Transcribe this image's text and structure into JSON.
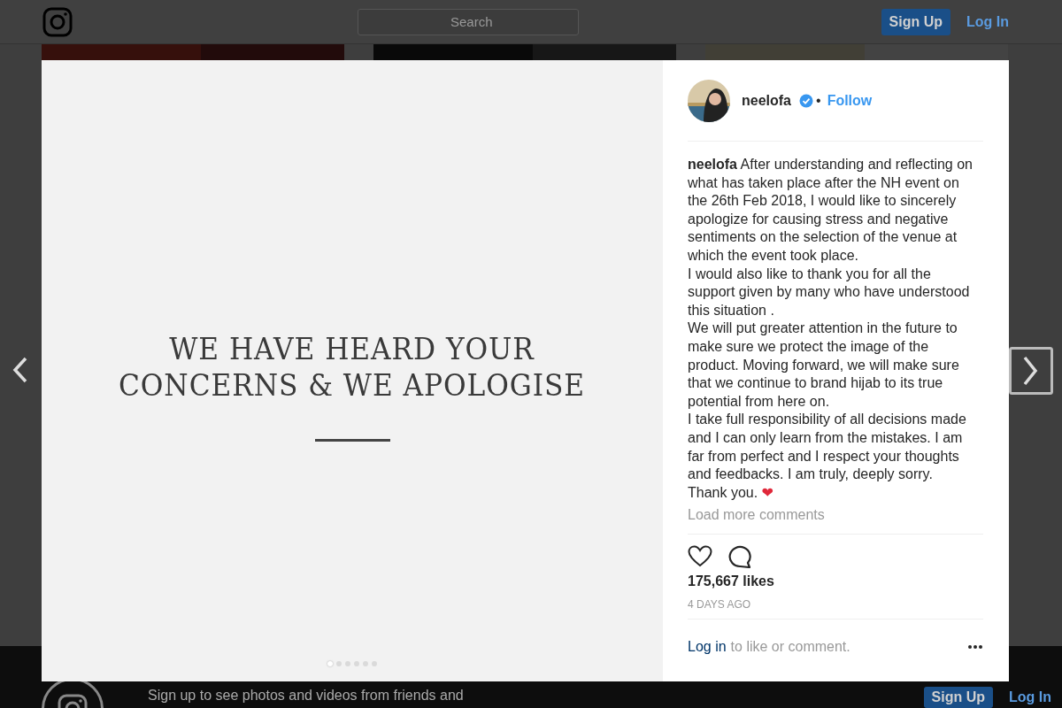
{
  "header": {
    "search": {
      "placeholder": "Search"
    },
    "sign_up": "Sign Up",
    "log_in": "Log In"
  },
  "post": {
    "slide": {
      "headline": "WE HAVE HEARD YOUR\nCONCERNS & WE APOLOGISE",
      "dots": [
        {
          "selected": true
        },
        {
          "selected": false
        },
        {
          "selected": false
        },
        {
          "selected": false
        },
        {
          "selected": false
        },
        {
          "selected": false
        }
      ]
    },
    "author": {
      "username": "neelofa",
      "verified": true,
      "separator": "•",
      "follow": "Follow"
    },
    "caption": "**neelofa** After understanding and reflecting on what has taken place after the NH event on the 26th Feb 2018, I would like to sincerely apologize for causing stress and negative sentiments on the selection of the venue at which the event took place.\nI would also like to thank you for all the support given by many who have understood this situation .\nWe will put greater attention in the future to make sure we protect the image of the product. Moving forward, we will make sure that we continue to brand hijab to its true potential from here on.\nI take full responsibility of all decisions made and I can only learn from the mistakes. I am far from perfect and I respect your thoughts and feedbacks. I am truly, deeply sorry. Thank you.",
    "caption_emoji": "❤",
    "load_more": "Load more comments",
    "likes": "175,667 likes",
    "time": "4 DAYS AGO",
    "login_link": "Log in",
    "login_text": "to like or comment."
  },
  "footer": {
    "text": "Sign up to see photos and videos from friends and",
    "sign_up": "Sign Up",
    "log_in": "Log In"
  }
}
